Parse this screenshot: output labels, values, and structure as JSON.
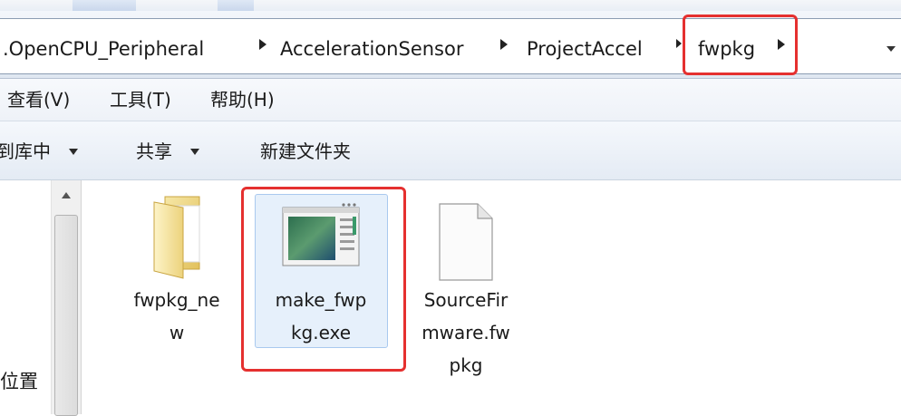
{
  "address_bar": {
    "breadcrumbs": [
      ".OpenCPU_Peripheral",
      "AccelerationSensor",
      "ProjectAccel",
      "fwpkg"
    ]
  },
  "menu": [
    "查看(V)",
    "工具(T)",
    "帮助(H)"
  ],
  "toolbar": {
    "include_library": "到库中",
    "share": "共享",
    "new_folder": "新建文件夹"
  },
  "nav": {
    "partial_label": "位置"
  },
  "files": [
    {
      "name_line1": "fwpkg_ne",
      "name_line2": "w",
      "type": "folder-icon"
    },
    {
      "name_line1": "make_fwp",
      "name_line2": "kg.exe",
      "type": "application-icon",
      "selected": true
    },
    {
      "name_line1": "SourceFir",
      "name_line2": "mware.fw",
      "name_line3": "pkg",
      "type": "document-icon"
    }
  ],
  "colors": {
    "highlight_box": "#e5302f",
    "selection": "#e6f0fb"
  }
}
